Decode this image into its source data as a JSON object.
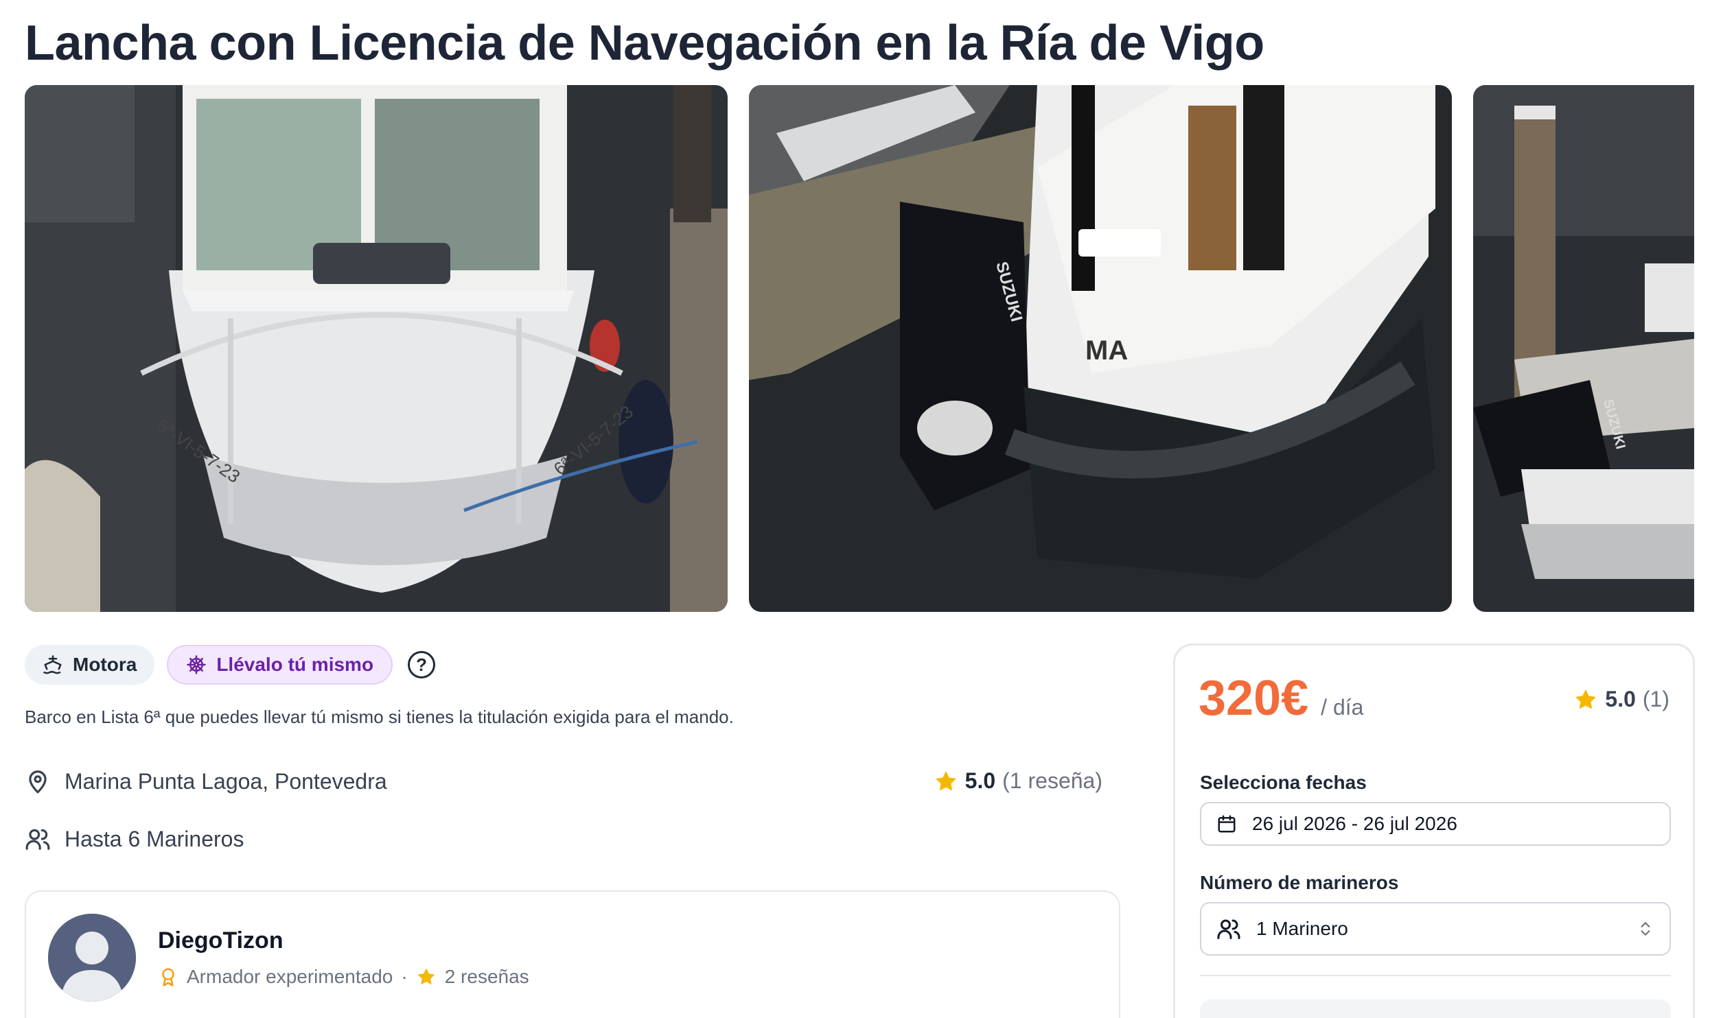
{
  "listing": {
    "title": "Lancha con Licencia de Navegación en la Ría de Vigo",
    "tags": {
      "motor": "Motora",
      "self_drive": "Llévalo tú mismo",
      "help": "?"
    },
    "description": "Barco en Lista 6ª que puedes llevar tú mismo si tienes la titulación exigida para el mando.",
    "location": "Marina Punta Lagoa, Pontevedra",
    "capacity": "Hasta 6 Marineros",
    "rating": {
      "value": "5.0",
      "count": "(1 reseña)"
    },
    "photos": [
      {
        "icon": "boat-bow-photo",
        "registration": "6ª-VI-5-7-23"
      },
      {
        "icon": "boat-stern-outboard-photo",
        "hull_text": "MA",
        "engine_brand": "SUZUKI"
      },
      {
        "icon": "boat-side-photo",
        "engine_brand": "SUZUKI"
      }
    ]
  },
  "owner": {
    "name": "DiegoTizon",
    "badge": "Armador experimentado",
    "separator": "·",
    "reviews": "2 reseñas"
  },
  "booking": {
    "price": "320€",
    "price_unit": "/ día",
    "rating_value": "5.0",
    "rating_count": "(1)",
    "dates_label": "Selecciona fechas",
    "dates_value": "26 jul 2026 - 26 jul 2026",
    "crew_label": "Número de marineros",
    "crew_value": "1 Marinero"
  },
  "colors": {
    "price": "#f26b3a",
    "star": "#f5b800",
    "self_tag_bg": "#f3e8ff",
    "self_tag_text": "#6b21a8",
    "title": "#1e2536",
    "badge_icon": "#f59e0b"
  }
}
